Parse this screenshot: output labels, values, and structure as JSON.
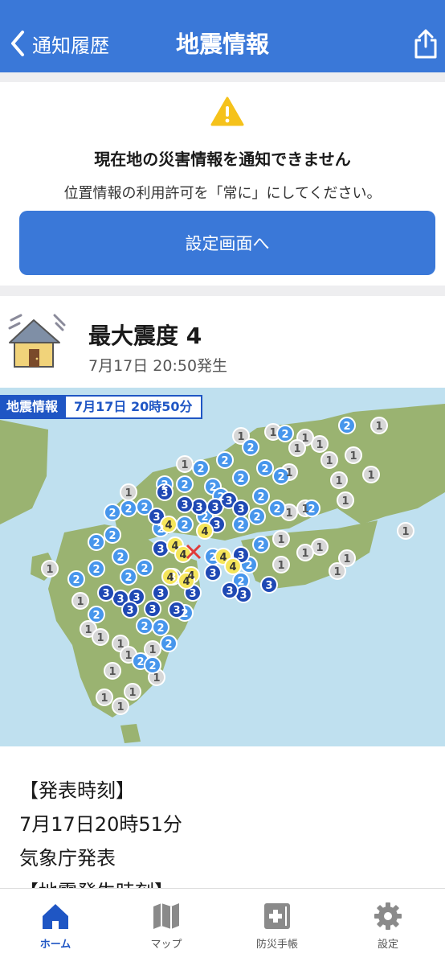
{
  "nav": {
    "back_label": "通知履歴",
    "title": "地震情報",
    "share_icon": "share-icon"
  },
  "notice": {
    "title": "現在地の災害情報を通知できません",
    "subtitle": "位置情報の利用許可を「常に」にしてください。",
    "button_label": "設定画面へ",
    "icon": "warning-icon"
  },
  "quake": {
    "title": "最大震度 4",
    "time": "7月17日 20:50発生",
    "icon": "house-shaking-icon"
  },
  "map": {
    "badge_label": "地震情報",
    "badge_time": "7月17日 20時50分"
  },
  "detail": {
    "lines": [
      "【発表時刻】",
      "7月17日20時51分",
      "気象庁発表",
      "【地震発生時刻】"
    ]
  },
  "tabs": [
    {
      "label": "ホーム",
      "icon": "home-icon",
      "active": true
    },
    {
      "label": "マップ",
      "icon": "map-icon",
      "active": false
    },
    {
      "label": "防災手帳",
      "icon": "first-aid-notebook-icon",
      "active": false
    },
    {
      "label": "設定",
      "icon": "gear-icon",
      "active": false
    }
  ],
  "colors": {
    "primary": "#3a78d8",
    "sea": "#bfe0ef",
    "land": "#9ab371",
    "int1": "#d7d7d7",
    "int2": "#4796ec",
    "int3": "#1f49b4",
    "int4": "#f5e55a"
  }
}
